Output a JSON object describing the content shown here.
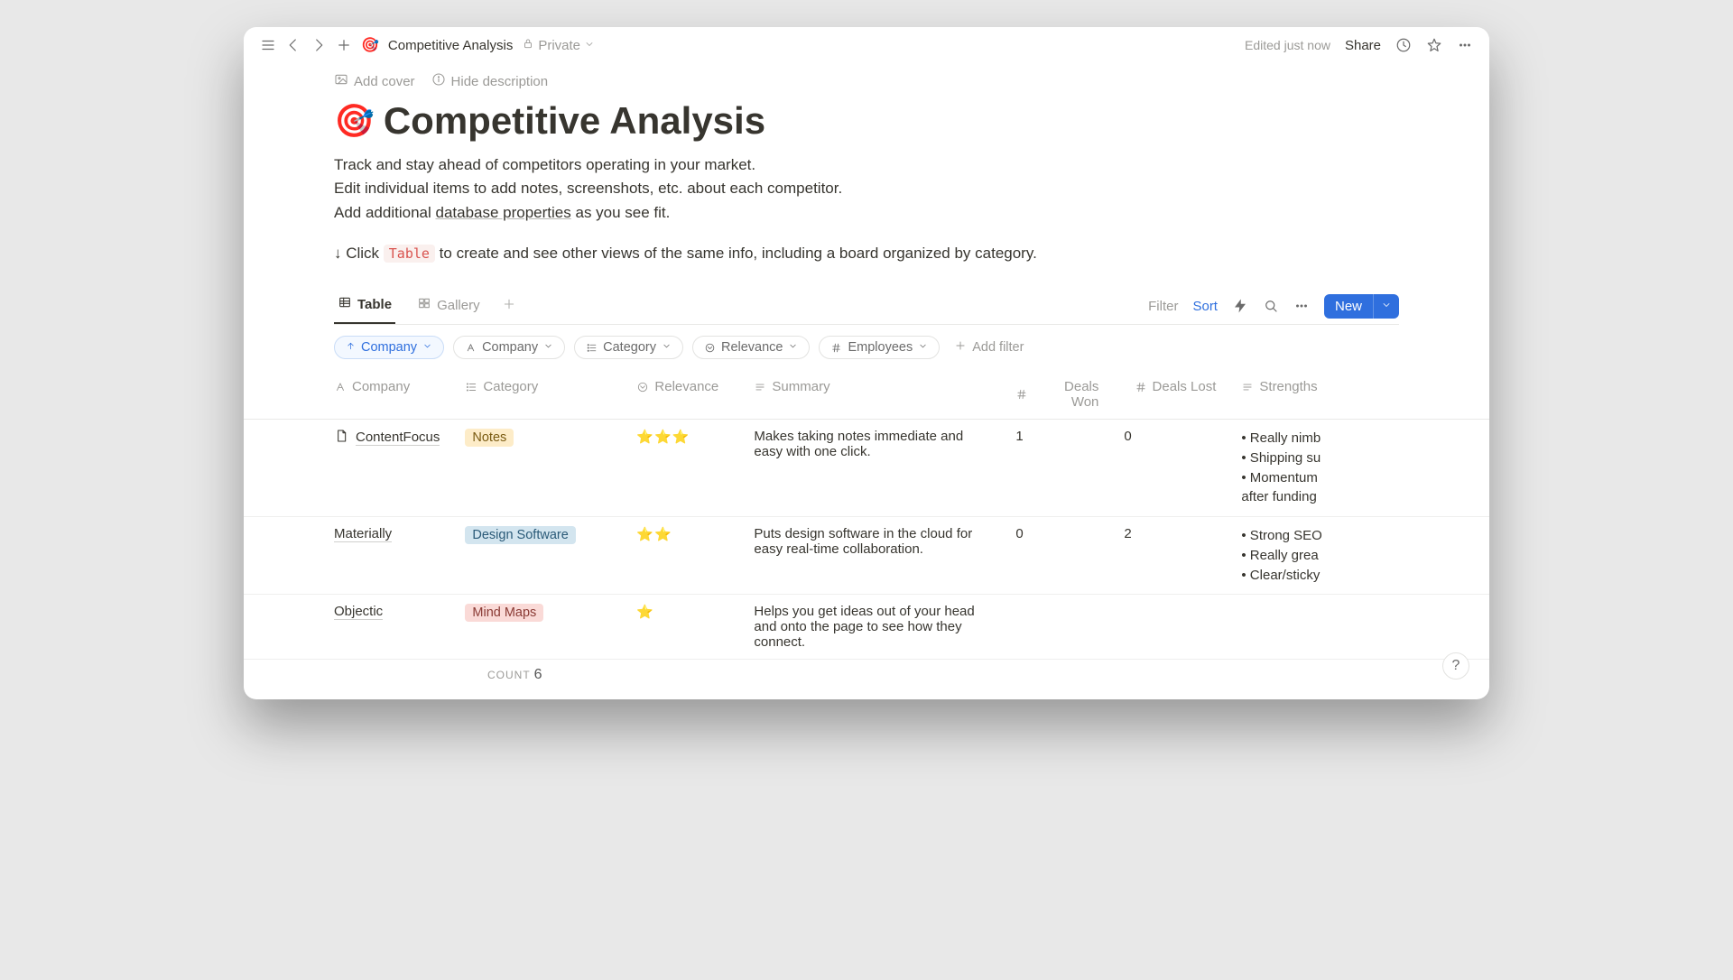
{
  "topbar": {
    "emoji": "🎯",
    "title": "Competitive Analysis",
    "privacy": "Private",
    "edited": "Edited just now",
    "share": "Share"
  },
  "cover": {
    "add_cover": "Add cover",
    "hide_desc": "Hide description"
  },
  "page": {
    "emoji": "🎯",
    "title": "Competitive Analysis",
    "desc_line1": "Track and stay ahead of competitors operating in your market.",
    "desc_line2": "Edit individual items to add notes, screenshots, etc. about each competitor.",
    "desc_line3_a": "Add additional ",
    "desc_line3_link": "database properties",
    "desc_line3_b": " as you see fit.",
    "hint_a": "↓ Click ",
    "hint_code": "Table",
    "hint_b": " to create and see other views of the same info, including a board organized by category."
  },
  "views": {
    "table": "Table",
    "gallery": "Gallery"
  },
  "toolbar": {
    "filter": "Filter",
    "sort": "Sort",
    "new": "New"
  },
  "filters": {
    "sort_pill": "Company",
    "company": "Company",
    "category": "Category",
    "relevance": "Relevance",
    "employees": "Employees",
    "add_filter": "Add filter"
  },
  "columns": {
    "company": "Company",
    "category": "Category",
    "relevance": "Relevance",
    "summary": "Summary",
    "deals_won": "Deals Won",
    "deals_lost": "Deals Lost",
    "strengths": "Strengths"
  },
  "rows": [
    {
      "company": "ContentFocus",
      "category": "Notes",
      "category_class": "notes",
      "relevance": "⭐⭐⭐",
      "summary": "Makes taking notes immediate and easy with one click.",
      "deals_won": "1",
      "deals_lost": "0",
      "strengths": "• Really nimb\n• Shipping su\n• Momentum\nafter funding"
    },
    {
      "company": "Materially",
      "category": "Design Software",
      "category_class": "design",
      "relevance": "⭐⭐",
      "summary": "Puts design software in the cloud for easy real-time collaboration.",
      "deals_won": "0",
      "deals_lost": "2",
      "strengths": "• Strong SEO\n• Really grea\n• Clear/sticky"
    },
    {
      "company": "Objectic",
      "category": "Mind Maps",
      "category_class": "mind",
      "relevance": "⭐",
      "summary": "Helps you get ideas out of your head and onto the page to see how they connect.",
      "deals_won": "",
      "deals_lost": "",
      "strengths": ""
    }
  ],
  "count": {
    "label": "COUNT",
    "value": "6"
  }
}
